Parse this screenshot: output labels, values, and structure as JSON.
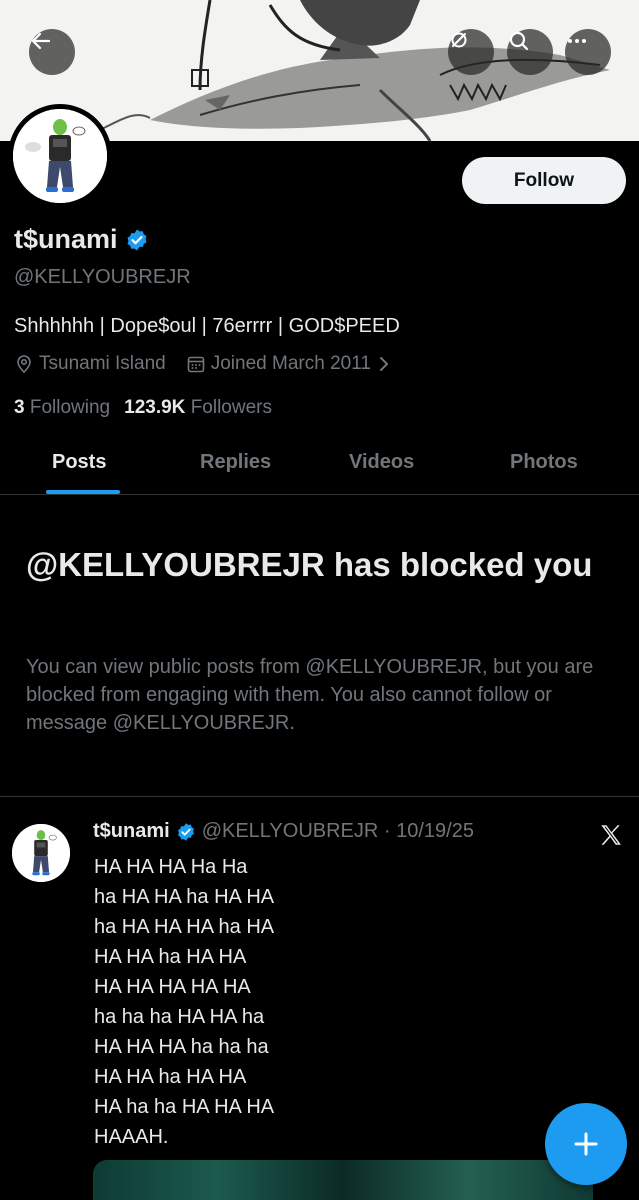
{
  "profile": {
    "display_name": "t$unami",
    "handle": "@KELLYOUBREJR",
    "bio": "Shhhhhh | Dope$oul | 76errrr | GOD$PEED",
    "location": "Tsunami Island",
    "joined": "Joined March 2011",
    "following_count": "3",
    "following_label": "Following",
    "followers_count": "123.9K",
    "followers_label": "Followers",
    "follow_button": "Follow"
  },
  "tabs": [
    "Posts",
    "Replies",
    "Videos",
    "Photos"
  ],
  "blocked": {
    "title": "@KELLYOUBREJR has blocked you",
    "description": "You can view public posts from @KELLYOUBREJR, but you are blocked from engaging with them. You also cannot follow or message @KELLYOUBREJR."
  },
  "post": {
    "author": "t$unami",
    "handle_date": "@KELLYOUBREJR · 10/19/25",
    "lines": [
      "HA HA HA Ha Ha",
      "ha HA HA ha HA HA",
      "ha HA HA HA ha HA",
      "HA HA ha HA HA",
      "HA HA HA HA HA",
      "ha ha ha HA HA ha",
      "HA HA HA ha ha ha",
      "HA HA ha HA HA",
      "HA ha ha HA HA HA",
      "HAAAH."
    ]
  },
  "icons": {
    "back": "back-arrow-icon",
    "link": "link-icon",
    "search": "search-icon",
    "more": "more-icon",
    "verified": "verified-badge-icon",
    "location": "location-pin-icon",
    "calendar": "calendar-icon",
    "chevron": "chevron-right-icon",
    "x_logo": "x-logo-icon",
    "compose": "plus-icon"
  },
  "colors": {
    "accent": "#1d9bf0",
    "muted": "#71767b",
    "background": "#000000"
  }
}
